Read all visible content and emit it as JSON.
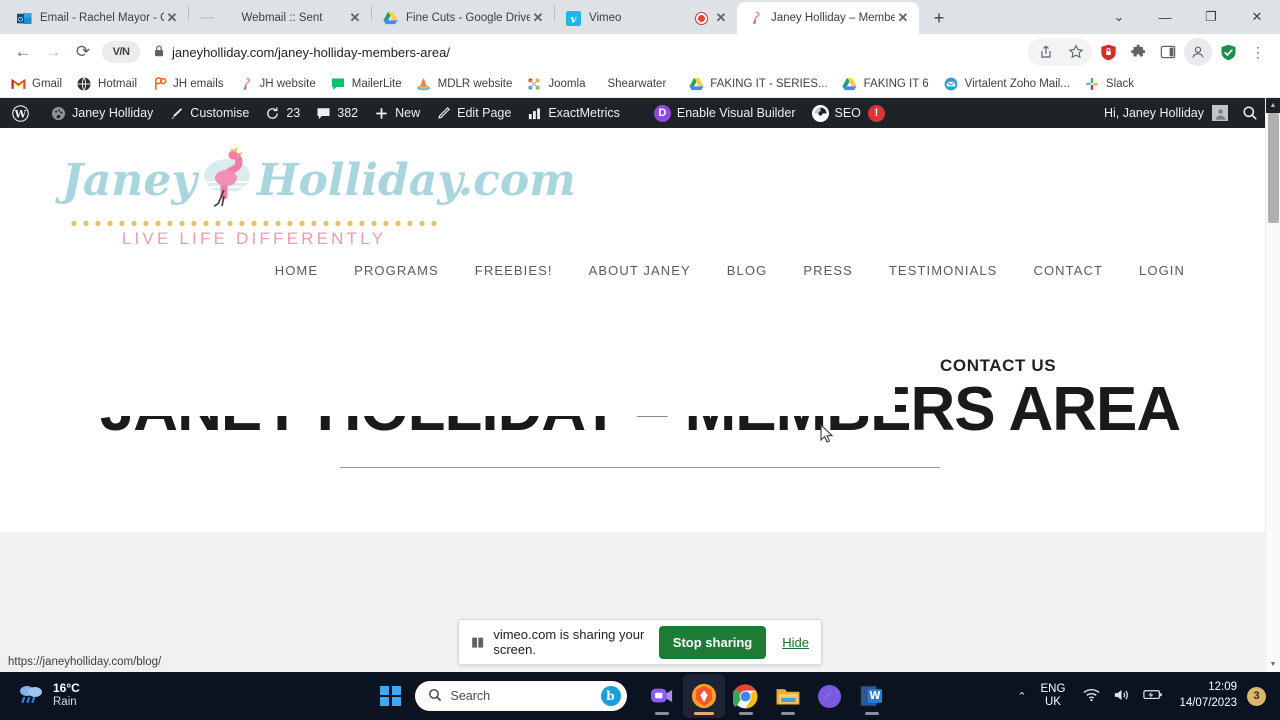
{
  "browser": {
    "tabs": [
      {
        "title": "Email - Rachel Mayor - O...",
        "icon": "outlook-icon",
        "active": false,
        "recording": false
      },
      {
        "title": "Webmail :: Sent",
        "icon": "blank-icon",
        "active": false,
        "recording": false
      },
      {
        "title": "Fine Cuts - Google Drive",
        "icon": "google-drive-icon",
        "active": false,
        "recording": false
      },
      {
        "title": "Vimeo",
        "icon": "vimeo-icon",
        "active": false,
        "recording": true
      },
      {
        "title": "Janey Holliday – Members",
        "icon": "flamingo-icon",
        "active": true,
        "recording": false
      }
    ],
    "new_tab_label": "+",
    "window_controls": {
      "list": "⌄",
      "minimize": "—",
      "maximize": "❐",
      "close": "✕"
    },
    "nav": {
      "back": "←",
      "forward": "→",
      "reload": "⟳",
      "vpn_label": "V/N"
    },
    "omnibox": {
      "lock": "🔒",
      "url": "janeyholliday.com/janey-holliday-members-area/"
    },
    "toolbar_icons": [
      "share-icon",
      "bookmark-star-icon",
      "lastpass-icon",
      "extensions-puzzle-icon",
      "side-panel-icon",
      "profile-avatar-icon",
      "shield-check-icon",
      "chrome-menu-icon"
    ],
    "bookmarks": [
      {
        "label": "Gmail",
        "icon": "gmail-icon"
      },
      {
        "label": "Hotmail",
        "icon": "hotmail-icon"
      },
      {
        "label": "JH emails",
        "icon": "jh-emails-icon"
      },
      {
        "label": "JH website",
        "icon": "flamingo-icon"
      },
      {
        "label": "MailerLite",
        "icon": "mailerlite-icon"
      },
      {
        "label": "MDLR website",
        "icon": "mdlr-icon"
      },
      {
        "label": "Joomla",
        "icon": "joomla-icon"
      },
      {
        "label": "Shearwater",
        "icon": "none"
      },
      {
        "label": "FAKING IT - SERIES...",
        "icon": "google-drive-icon"
      },
      {
        "label": "FAKING IT 6",
        "icon": "google-drive-icon"
      },
      {
        "label": "Virtalent Zoho Mail...",
        "icon": "zoho-mail-icon"
      },
      {
        "label": "Slack",
        "icon": "slack-icon"
      }
    ],
    "status_link": "https://janeyholliday.com/blog/"
  },
  "wp_admin_bar": {
    "logo": "wordpress-icon",
    "items": [
      {
        "label": "Janey Holliday",
        "icon": "dashboard-icon"
      },
      {
        "label": "Customise",
        "icon": "paintbrush-icon"
      },
      {
        "label": "23",
        "icon": "updates-icon"
      },
      {
        "label": "382",
        "icon": "comments-icon"
      },
      {
        "label": "New",
        "icon": "plus-icon"
      },
      {
        "label": "Edit Page",
        "icon": "pencil-icon"
      },
      {
        "label": "ExactMetrics",
        "icon": "bar-chart-icon"
      },
      {
        "label": "Enable Visual Builder",
        "icon": "divi-icon"
      },
      {
        "label": "SEO",
        "icon": "yoast-icon"
      }
    ],
    "seo_badge": "!",
    "greeting": "Hi, Janey Holliday",
    "search_icon": "search-icon"
  },
  "site": {
    "logo": {
      "name": "Janey",
      "domain": "Holliday.com",
      "tagline": "LIVE LIFE DIFFERENTLY"
    },
    "nav": [
      {
        "label": "HOME"
      },
      {
        "label": "PROGRAMS"
      },
      {
        "label": "FREEBIES!"
      },
      {
        "label": "ABOUT JANEY"
      },
      {
        "label": "BLOG"
      },
      {
        "label": "PRESS"
      },
      {
        "label": "TESTIMONIALS"
      },
      {
        "label": "CONTACT"
      },
      {
        "label": "LOGIN"
      }
    ],
    "hero_title": "JANEY HOLLIDAY – MEMBERS AREA",
    "contact_heading": "CONTACT US"
  },
  "share_bar": {
    "pause_icon": "pause-icon",
    "message": "vimeo.com is sharing your screen.",
    "stop_label": "Stop sharing",
    "hide_label": "Hide",
    "accent": "#1e7b36"
  },
  "taskbar": {
    "weather": {
      "temp": "16°C",
      "condition": "Rain",
      "icon": "rain-cloud-icon"
    },
    "start": "windows-start-icon",
    "search": {
      "placeholder": "Search",
      "assistant": "bing-chat-icon"
    },
    "apps": [
      {
        "name": "teams-icon",
        "active": false,
        "open": true
      },
      {
        "name": "brave-icon",
        "active": true,
        "open": true
      },
      {
        "name": "chrome-icon",
        "active": false,
        "open": true
      },
      {
        "name": "file-explorer-icon",
        "active": false,
        "open": true
      },
      {
        "name": "microsoft-365-icon",
        "active": false,
        "open": false
      },
      {
        "name": "word-icon",
        "active": false,
        "open": true
      }
    ],
    "tray": {
      "chevron": "show-hidden-icons-icon",
      "language": "ENG",
      "language_region": "UK",
      "icons": [
        "wifi-icon",
        "volume-icon",
        "battery-icon"
      ],
      "time": "12:09",
      "date": "14/07/2023",
      "notification_count": "3"
    }
  }
}
